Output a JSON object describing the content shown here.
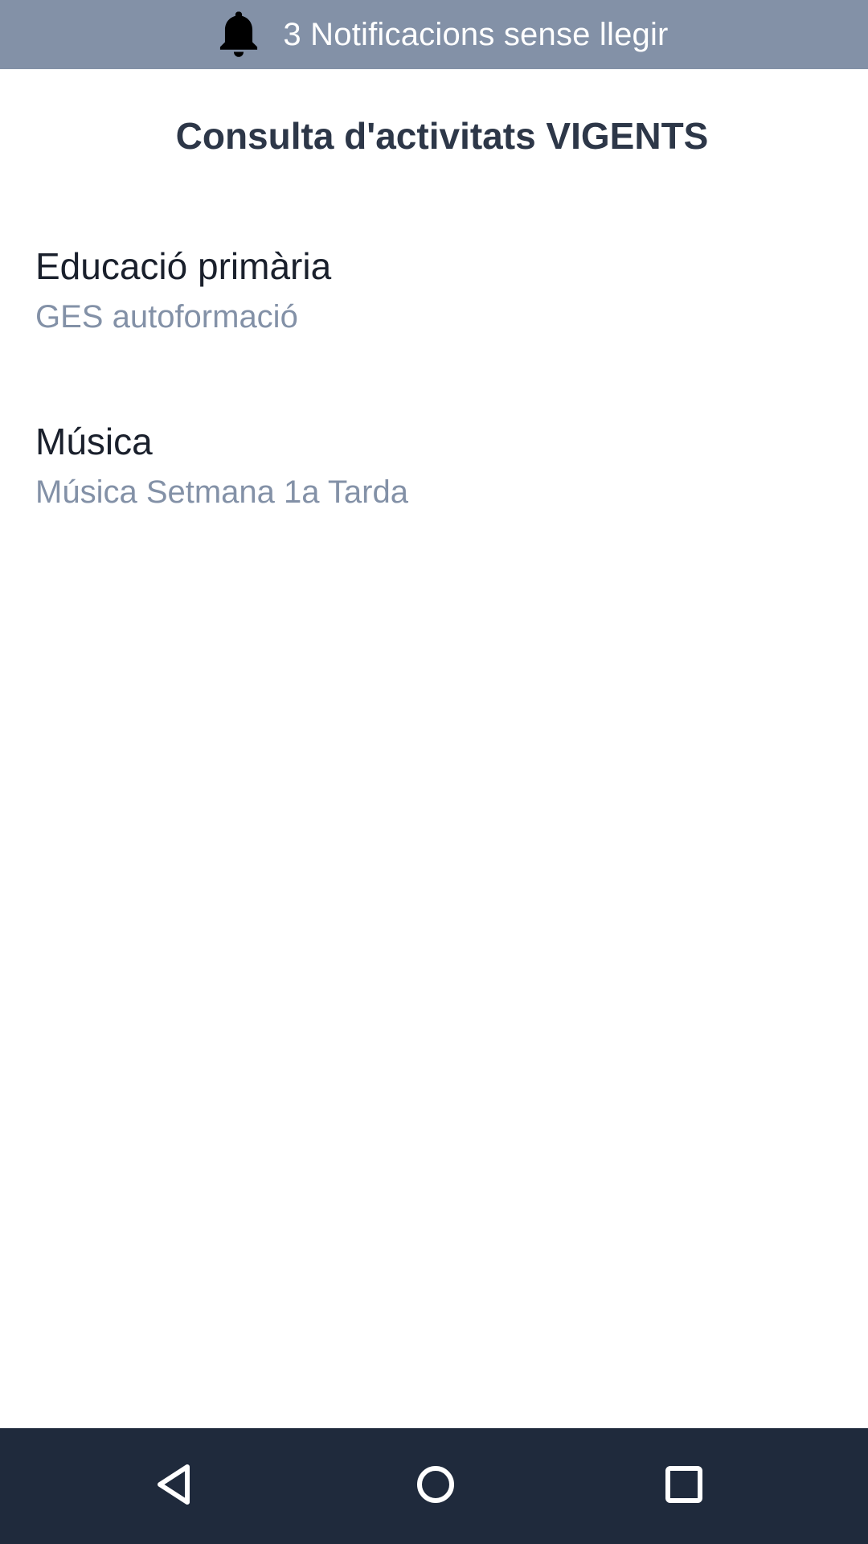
{
  "notification_bar": {
    "icon": "bell-icon",
    "text": "3 Notificacions sense llegir",
    "background": "#8391a7"
  },
  "page": {
    "title": "Consulta d'activitats VIGENTS"
  },
  "activities": [
    {
      "title": "Educació primària",
      "subtitle": "GES autoformació"
    },
    {
      "title": "Música",
      "subtitle": "Música Setmana 1a Tarda"
    }
  ],
  "nav_bar": {
    "background": "#1f2a3c",
    "buttons": [
      "back-icon",
      "home-icon",
      "recents-icon"
    ]
  },
  "colors": {
    "title": "#2d3748",
    "item_title": "#1a202c",
    "item_subtitle": "#8391a7"
  }
}
